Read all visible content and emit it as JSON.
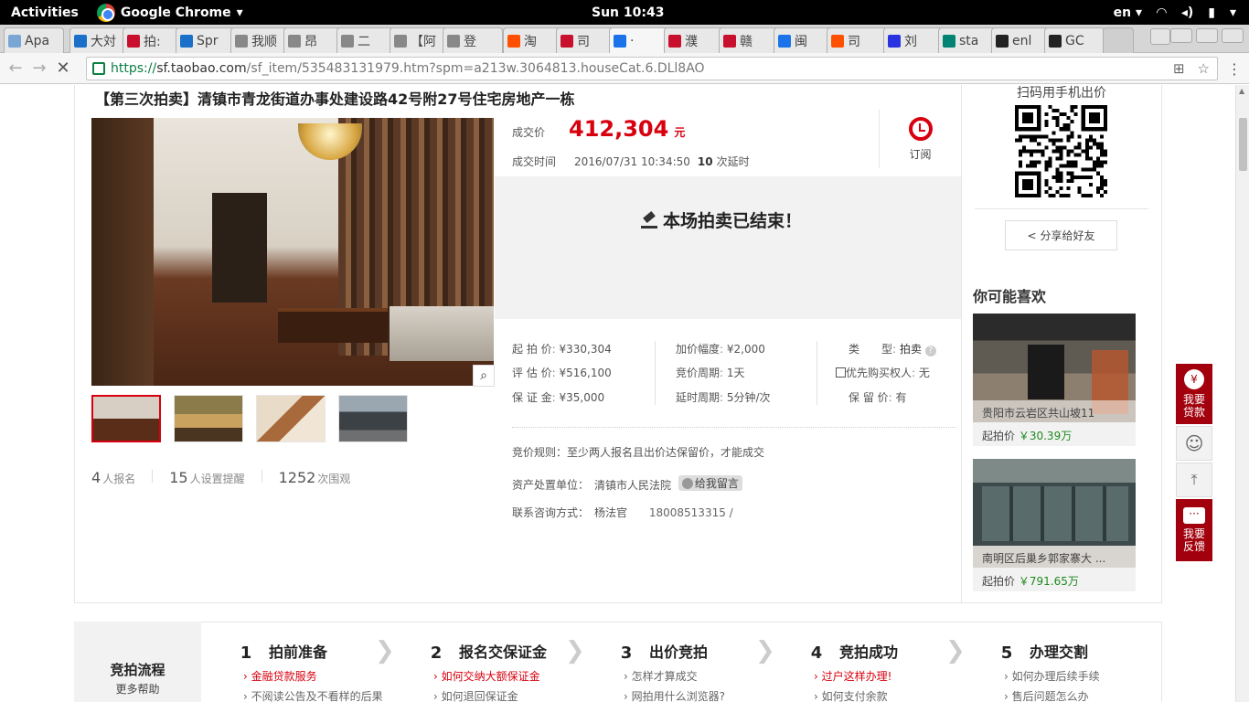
{
  "system_bar": {
    "activities": "Activities",
    "app_name": "Google Chrome",
    "clock": "Sun 10:43",
    "lang": "en"
  },
  "tabs": [
    {
      "label": "Apa",
      "color": "#7aa6d6"
    },
    {
      "label": "大対",
      "color": "#1a6fc9"
    },
    {
      "label": "拍:",
      "color": "#c8102e"
    },
    {
      "label": "Spr",
      "color": "#1a6fc9"
    },
    {
      "label": "我顺",
      "color": "#888888"
    },
    {
      "label": "昂",
      "color": "#888888"
    },
    {
      "label": "二 ",
      "color": "#888888"
    },
    {
      "label": "【阿",
      "color": "#888888"
    },
    {
      "label": "登",
      "color": "#888888"
    },
    {
      "label": "淘",
      "color": "#ff5000"
    },
    {
      "label": "司",
      "color": "#c8102e"
    },
    {
      "label": "·",
      "color": "#1a73e8"
    },
    {
      "label": "濮",
      "color": "#c8102e"
    },
    {
      "label": "赣",
      "color": "#c8102e"
    },
    {
      "label": "闽",
      "color": "#1a73e8"
    },
    {
      "label": "司",
      "color": "#ff5000"
    },
    {
      "label": "刘",
      "color": "#2932e1"
    },
    {
      "label": "sta",
      "color": "#008373"
    },
    {
      "label": "enl",
      "color": "#222222"
    },
    {
      "label": "GC",
      "color": "#222222"
    }
  ],
  "address_bar": {
    "scheme": "https://",
    "host": "sf.taobao.com",
    "path": "/sf_item/535483131979.htm?spm=a213w.3064813.houseCat.6.DLl8AO"
  },
  "item": {
    "title": "【第三次拍卖】清镇市青龙街道办事处建设路42号附27号住宅房地产一栋",
    "deal_price_label": "成交价",
    "deal_price": "412,304",
    "currency": "元",
    "deal_time_label": "成交时间",
    "deal_time": "2016/07/31 10:34:50",
    "delay_count": "10",
    "delay_suffix": "次延时",
    "subscribe": "订阅",
    "ended": "本场拍卖已结束！",
    "info": [
      {
        "k": "起 拍 价",
        "v": "¥330,304"
      },
      {
        "k": "评 估 价",
        "v": "¥516,100"
      },
      {
        "k": "保 证 金",
        "v": "¥35,000"
      },
      {
        "k": "加价幅度",
        "v": "¥2,000"
      },
      {
        "k": "竞价周期",
        "v": "1天"
      },
      {
        "k": "延时周期",
        "v": "5分钟/次"
      },
      {
        "k": "类　　型",
        "v": "拍卖"
      },
      {
        "k": "优先购买权人",
        "v": "无"
      },
      {
        "k": "保 留 价",
        "v": "有"
      }
    ],
    "rule": "竞价规则：至少两人报名且出价达保留价，才能成交",
    "agency_label": "资产处置单位：",
    "agency": "清镇市人民法院",
    "message_btn": "给我留言",
    "contact_label": "联系咨询方式：",
    "contact_name": "杨法官",
    "contact_phone": "18008513315 /",
    "stats": [
      {
        "num": "4",
        "label": "人报名"
      },
      {
        "num": "15",
        "label": "人设置提醒"
      },
      {
        "num": "1252",
        "label": "次围观"
      }
    ]
  },
  "sidebar": {
    "qr_label": "扫码用手机出价",
    "share": "分享给好友",
    "like_title": "你可能喜欢",
    "cards": [
      {
        "caption": "贵阳市云岩区共山坡11",
        "price_label": "起拍价",
        "price": "￥30.39万"
      },
      {
        "caption": "南明区后巢乡郭家寨大 ...",
        "price_label": "起拍价",
        "price": "￥791.65万"
      }
    ]
  },
  "float_buttons": {
    "loan": "我要\n贷款",
    "feedback": "我要\n反馈"
  },
  "process": {
    "title": "竞拍流程",
    "more": "更多帮助",
    "steps": [
      {
        "num": "1",
        "name": "拍前准备",
        "l1": "金融贷款服务",
        "l2": "不阅读公告及不看样的后果"
      },
      {
        "num": "2",
        "name": "报名交保证金",
        "l1": "如何交纳大额保证金",
        "l2": "如何退回保证金"
      },
      {
        "num": "3",
        "name": "出价竞拍",
        "l1": "怎样才算成交",
        "l2": "网拍用什么浏览器?"
      },
      {
        "num": "4",
        "name": "竞拍成功",
        "l1": "过户这样办理!",
        "l2": "如何支付余款"
      },
      {
        "num": "5",
        "name": "办理交割",
        "l1": "如何办理后续手续",
        "l2": "售后问题怎么办"
      }
    ]
  }
}
